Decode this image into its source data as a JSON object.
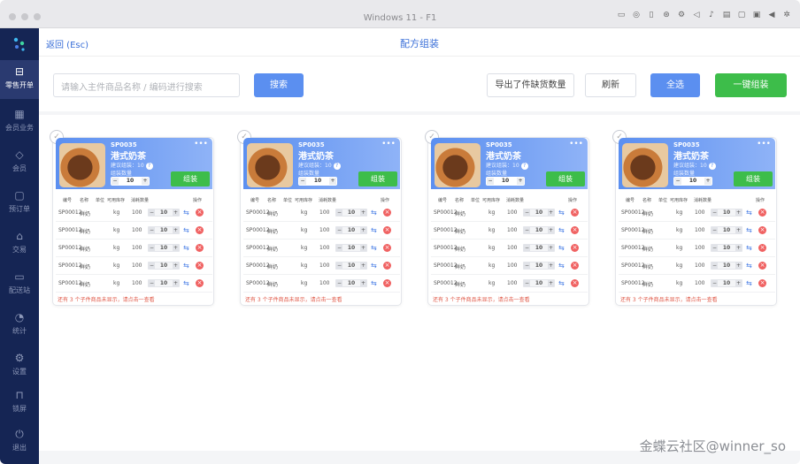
{
  "window": {
    "title": "Windows 11 - F1"
  },
  "sidebar": {
    "items": [
      {
        "label": "零售开单",
        "icon": "receipt-icon",
        "active": true
      },
      {
        "label": "会员业务",
        "icon": "grid-icon"
      },
      {
        "label": "会员",
        "icon": "diamond-icon"
      },
      {
        "label": "预订单",
        "icon": "order-icon"
      },
      {
        "label": "交易",
        "icon": "store-icon"
      },
      {
        "label": "配送站",
        "icon": "cashbox-icon"
      },
      {
        "label": "统计",
        "icon": "chart-icon"
      },
      {
        "label": "设置",
        "icon": "gear-icon"
      },
      {
        "label": "锁屏",
        "icon": "lock-icon"
      },
      {
        "label": "退出",
        "icon": "power-icon"
      }
    ]
  },
  "header": {
    "back": "返回 (Esc)",
    "title": "配方组装"
  },
  "toolbar": {
    "search_placeholder": "请输入主件商品名称 / 编码进行搜索",
    "search_btn": "搜索",
    "export_btn": "导出了件缺货数量",
    "refresh_btn": "刷新",
    "select_all_btn": "全选",
    "assemble_all_btn": "一键组装"
  },
  "cards": [
    {
      "code": "SP0035",
      "name": "港式奶茶",
      "suggest": "建议组装：10",
      "qty_label": "组装数量",
      "qty": "10",
      "assemble": "组装",
      "headers": [
        "编号",
        "名称",
        "单位",
        "可用库存",
        "消耗数量",
        "操作"
      ],
      "rows": [
        {
          "code": "SP00012",
          "name": "鲜奶",
          "unit": "kg",
          "stock": "100",
          "qty": "10"
        },
        {
          "code": "SP00012",
          "name": "鲜奶",
          "unit": "kg",
          "stock": "100",
          "qty": "10"
        },
        {
          "code": "SP00012",
          "name": "鲜奶",
          "unit": "kg",
          "stock": "100",
          "qty": "10"
        },
        {
          "code": "SP00012",
          "name": "鲜奶",
          "unit": "kg",
          "stock": "100",
          "qty": "10"
        },
        {
          "code": "SP00012",
          "name": "鲜奶",
          "unit": "kg",
          "stock": "100",
          "qty": "10"
        }
      ],
      "footnote": "还有 3 个子件商品未显示，请点击一查看"
    },
    {
      "code": "SP0035",
      "name": "港式奶茶",
      "suggest": "建议组装：10",
      "qty_label": "组装数量",
      "qty": "10",
      "assemble": "组装",
      "headers": [
        "编号",
        "名称",
        "单位",
        "可用库存",
        "消耗数量",
        "操作"
      ],
      "rows": [
        {
          "code": "SP00012",
          "name": "鲜奶",
          "unit": "kg",
          "stock": "100",
          "qty": "10"
        },
        {
          "code": "SP00012",
          "name": "鲜奶",
          "unit": "kg",
          "stock": "100",
          "qty": "10"
        },
        {
          "code": "SP00012",
          "name": "鲜奶",
          "unit": "kg",
          "stock": "100",
          "qty": "10"
        },
        {
          "code": "SP00012",
          "name": "鲜奶",
          "unit": "kg",
          "stock": "100",
          "qty": "10"
        },
        {
          "code": "SP00012",
          "name": "鲜奶",
          "unit": "kg",
          "stock": "100",
          "qty": "10"
        }
      ],
      "footnote": "还有 3 个子件商品未显示，请点击一查看"
    },
    {
      "code": "SP0035",
      "name": "港式奶茶",
      "suggest": "建议组装：10",
      "qty_label": "组装数量",
      "qty": "10",
      "assemble": "组装",
      "headers": [
        "编号",
        "名称",
        "单位",
        "可用库存",
        "消耗数量",
        "操作"
      ],
      "rows": [
        {
          "code": "SP00012",
          "name": "鲜奶",
          "unit": "kg",
          "stock": "100",
          "qty": "10"
        },
        {
          "code": "SP00012",
          "name": "鲜奶",
          "unit": "kg",
          "stock": "100",
          "qty": "10"
        },
        {
          "code": "SP00012",
          "name": "鲜奶",
          "unit": "kg",
          "stock": "100",
          "qty": "10"
        },
        {
          "code": "SP00012",
          "name": "鲜奶",
          "unit": "kg",
          "stock": "100",
          "qty": "10"
        },
        {
          "code": "SP00012",
          "name": "鲜奶",
          "unit": "kg",
          "stock": "100",
          "qty": "10"
        }
      ],
      "footnote": "还有 3 个子件商品未显示，请点击一查看"
    },
    {
      "code": "SP0035",
      "name": "港式奶茶",
      "suggest": "建议组装：10",
      "qty_label": "组装数量",
      "qty": "10",
      "assemble": "组装",
      "headers": [
        "编号",
        "名称",
        "单位",
        "可用库存",
        "消耗数量",
        "操作"
      ],
      "rows": [
        {
          "code": "SP00012",
          "name": "鲜奶",
          "unit": "kg",
          "stock": "100",
          "qty": "10"
        },
        {
          "code": "SP00012",
          "name": "鲜奶",
          "unit": "kg",
          "stock": "100",
          "qty": "10"
        },
        {
          "code": "SP00012",
          "name": "鲜奶",
          "unit": "kg",
          "stock": "100",
          "qty": "10"
        },
        {
          "code": "SP00012",
          "name": "鲜奶",
          "unit": "kg",
          "stock": "100",
          "qty": "10"
        },
        {
          "code": "SP00012",
          "name": "鲜奶",
          "unit": "kg",
          "stock": "100",
          "qty": "10"
        }
      ],
      "footnote": "还有 3 个子件商品未显示，请点击一查看"
    }
  ],
  "watermark": "金蝶云社区@winner_so",
  "colors": {
    "sidebar": "#152554",
    "primary": "#5b8ff0",
    "success": "#3dbd4a",
    "danger": "#f06262"
  }
}
